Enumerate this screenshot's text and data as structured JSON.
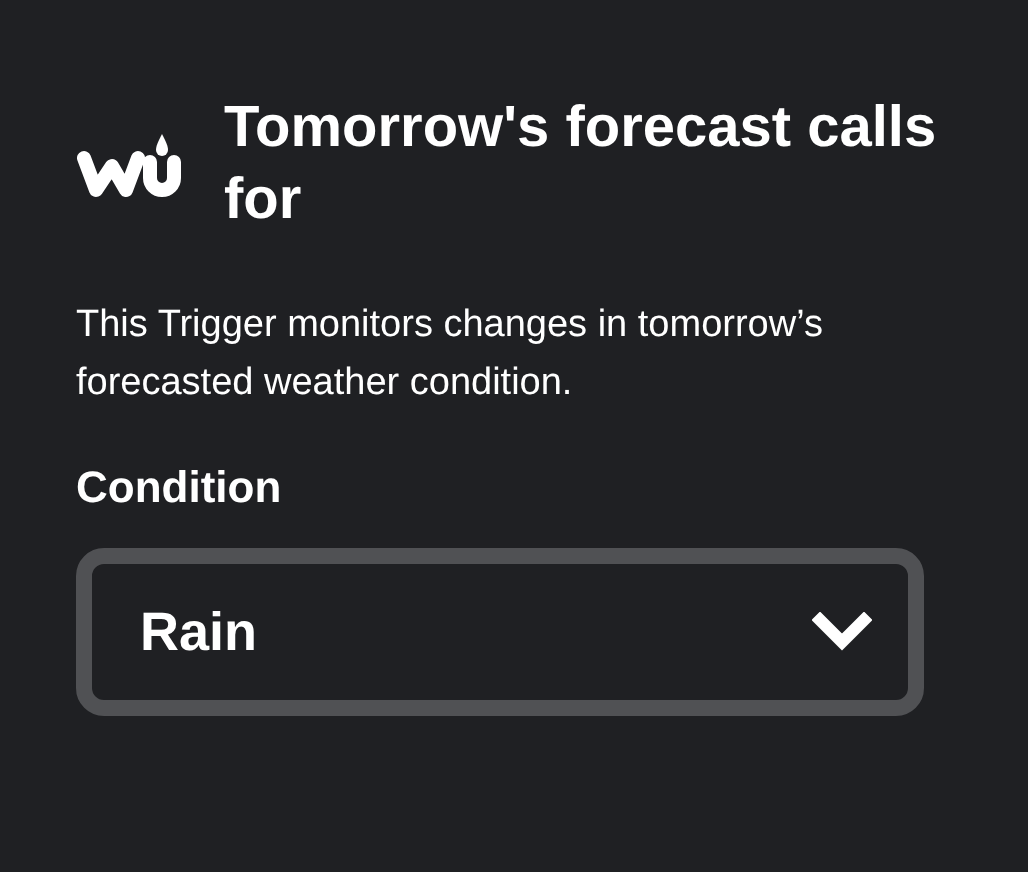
{
  "trigger": {
    "title": "Tomorrow's forecast calls for",
    "description": "This Trigger monitors changes in tomorrow’s forecasted weather condition."
  },
  "condition": {
    "label": "Condition",
    "value": "Rain"
  }
}
